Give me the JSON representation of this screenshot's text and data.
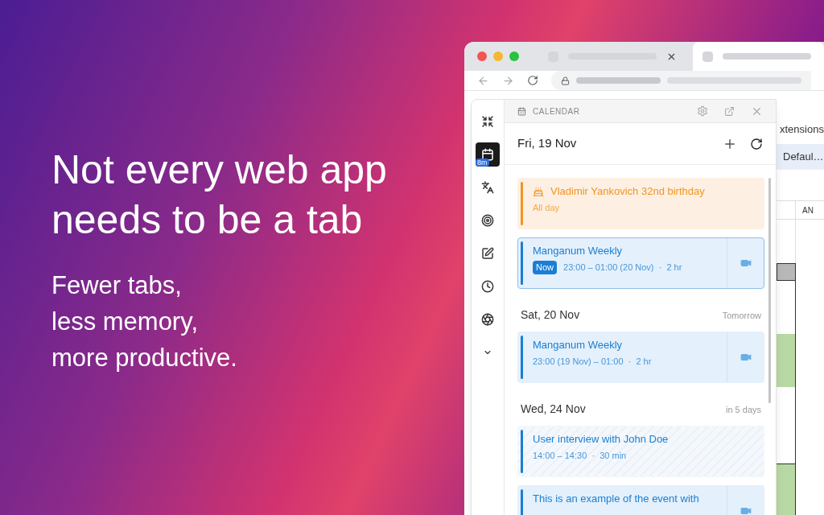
{
  "hero": {
    "headline": "Not every web app needs to be a tab",
    "subline": [
      "Fewer tabs,",
      "less memory,",
      "more productive."
    ]
  },
  "browser": {
    "tabs": [
      {
        "selected": false
      },
      {
        "selected": true
      }
    ]
  },
  "sidebar": {
    "items": [
      {
        "selected": false
      },
      {
        "selected": true,
        "badge": "8m"
      },
      {
        "selected": false
      },
      {
        "selected": false
      },
      {
        "selected": false
      },
      {
        "selected": false
      },
      {
        "selected": false
      },
      {
        "selected": false
      }
    ]
  },
  "panel": {
    "title": "CALENDAR",
    "date": "Fri, 19 Nov",
    "days": [
      {
        "events": [
          {
            "kind": "all_day",
            "color": "#f29423",
            "title": "Vladimir Yankovich 32nd birthday",
            "time": "All day",
            "video": false
          },
          {
            "kind": "meeting",
            "color": "#1a7fd4",
            "title": "Manganum Weekly",
            "time": "23:00 – 01:00 (20 Nov)  ·  2 hr",
            "now": "Now",
            "video": true
          }
        ]
      },
      {
        "label": "Sat, 20 Nov",
        "relative": "Tomorrow",
        "events": [
          {
            "kind": "meeting",
            "color": "#1a7fd4",
            "title": "Manganum Weekly",
            "time": "23:00 (19 Nov) – 01:00  ·  2 hr",
            "video": true
          }
        ]
      },
      {
        "label": "Wed, 24 Nov",
        "relative": "in 5 days",
        "events": [
          {
            "kind": "tentative",
            "color": "#1a7fd4",
            "title": "User interview with John Doe",
            "time": "14:00 – 14:30  ·  30 min",
            "video": false
          },
          {
            "kind": "meeting",
            "color": "#1a7fd4",
            "title": "This is an example of the event with",
            "video": true
          }
        ]
      }
    ]
  },
  "page_behind": {
    "menu_item": "xtensions",
    "dropdown": "Defaul…",
    "column_header": "AN"
  }
}
